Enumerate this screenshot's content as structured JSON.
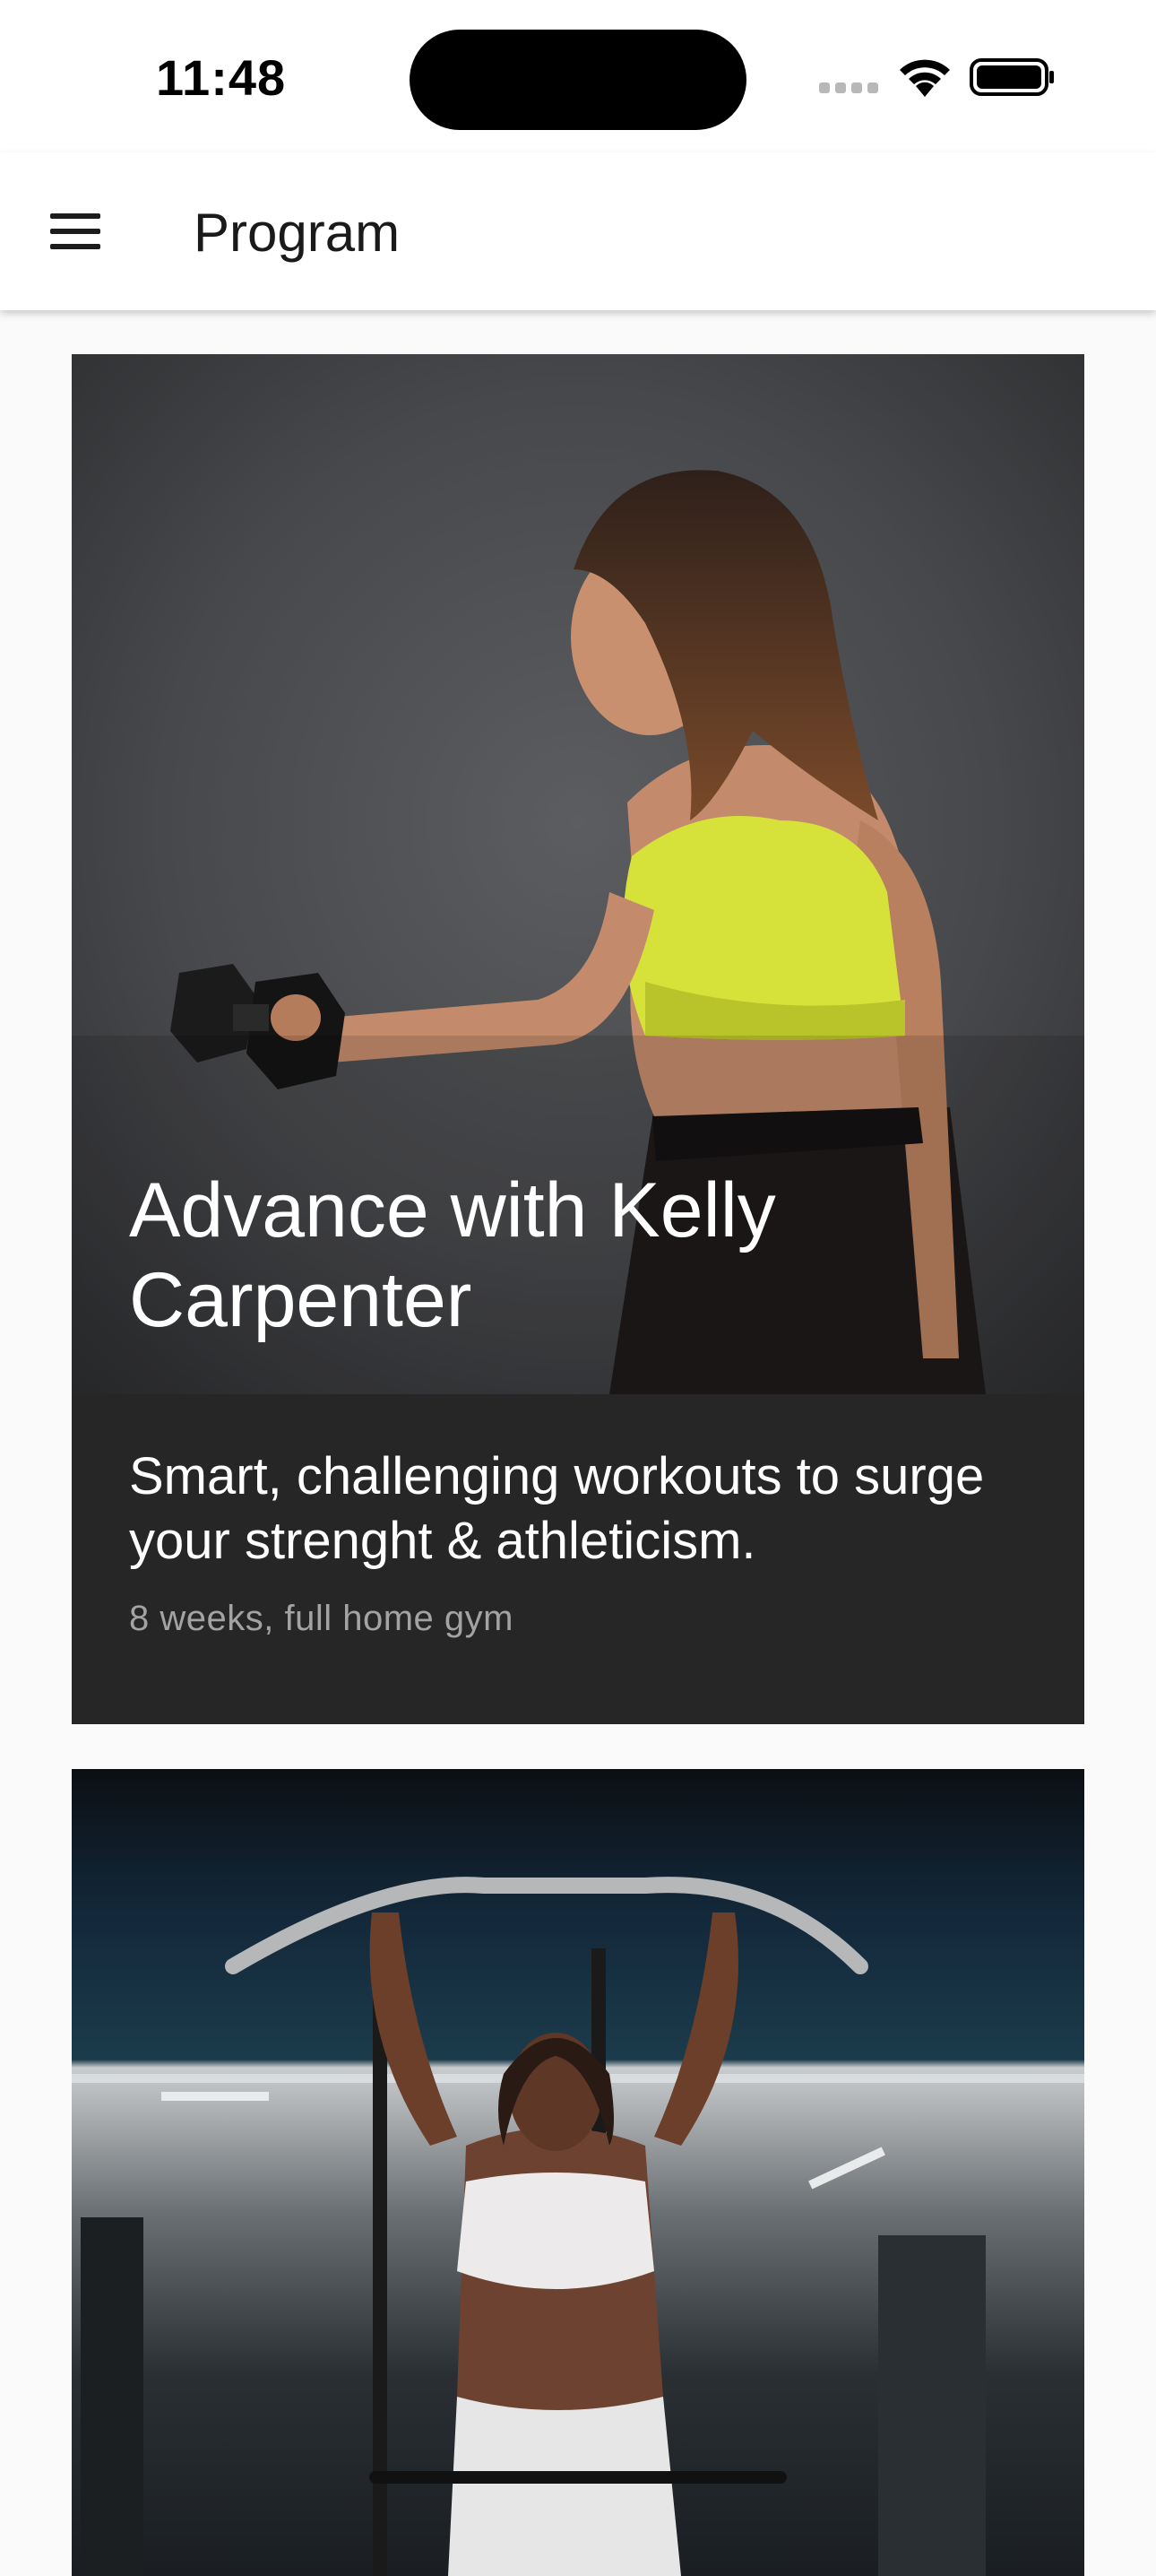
{
  "status_bar": {
    "time": "11:48"
  },
  "app_bar": {
    "title": "Program",
    "menu_icon": "hamburger-menu-icon"
  },
  "programs": [
    {
      "title": "Advance with Kelly Carpenter",
      "description": "Smart, challenging workouts to surge your strenght & athleticism.",
      "meta": "8 weeks, full home gym"
    },
    {
      "title": "",
      "description": "",
      "meta": ""
    }
  ],
  "colors": {
    "app_bar_bg": "#ffffff",
    "page_bg": "#fafafa",
    "card_bg": "#262626",
    "card_text": "#ffffff",
    "meta_text": "#a3a3a3"
  }
}
